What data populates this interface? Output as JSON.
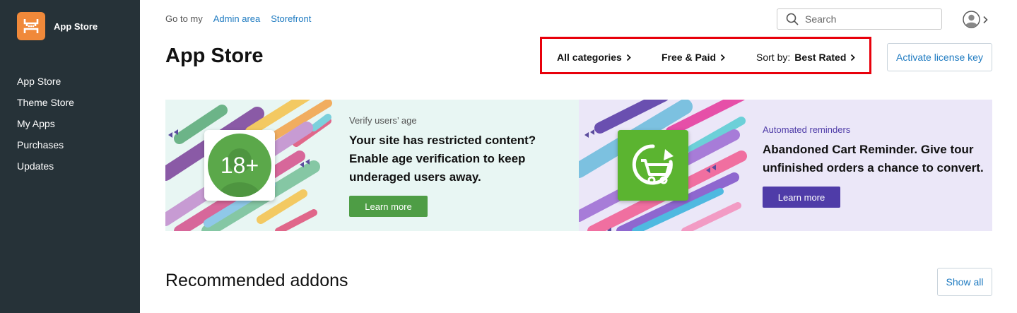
{
  "sidebar": {
    "app_title": "App Store",
    "items": [
      {
        "label": "App Store"
      },
      {
        "label": "Theme Store"
      },
      {
        "label": "My Apps"
      },
      {
        "label": "Purchases"
      },
      {
        "label": "Updates"
      }
    ]
  },
  "topbar": {
    "goto_label": "Go to my",
    "links": [
      "Admin area",
      "Storefront"
    ],
    "search_placeholder": "Search"
  },
  "header": {
    "title": "App Store",
    "filters": {
      "categories": "All categories",
      "pricing": "Free & Paid",
      "sort_prefix": "Sort by:",
      "sort_value": "Best Rated"
    },
    "license_button": "Activate license key"
  },
  "banners": [
    {
      "eyebrow": "Verify users’ age",
      "headline_lines": [
        "Your site has restricted content?",
        "Enable age verification to keep",
        "underaged users away."
      ],
      "badge_text": "18+",
      "cta": "Learn more"
    },
    {
      "eyebrow": "Automated reminders",
      "headline_lines": [
        "Abandoned Cart Reminder. Give tour",
        "unfinished orders a chance to convert."
      ],
      "cta": "Learn more"
    }
  ],
  "recommended": {
    "title": "Recommended addons",
    "show_all": "Show all"
  },
  "colors": {
    "sidebar_bg": "#263238",
    "logo_bg": "#f0893a",
    "link": "#1f7bc1",
    "highlight_border": "#e8000b",
    "banner1_bg": "#e8f6f3",
    "banner1_button": "#4e9d45",
    "banner2_bg": "#ebe7f8",
    "banner2_button": "#4f3ca8"
  },
  "icons": [
    "x-cart-logo-icon",
    "search-icon",
    "user-avatar-icon",
    "chevron-right-icon",
    "person-silhouette-icon",
    "shopping-cart-refresh-icon"
  ]
}
